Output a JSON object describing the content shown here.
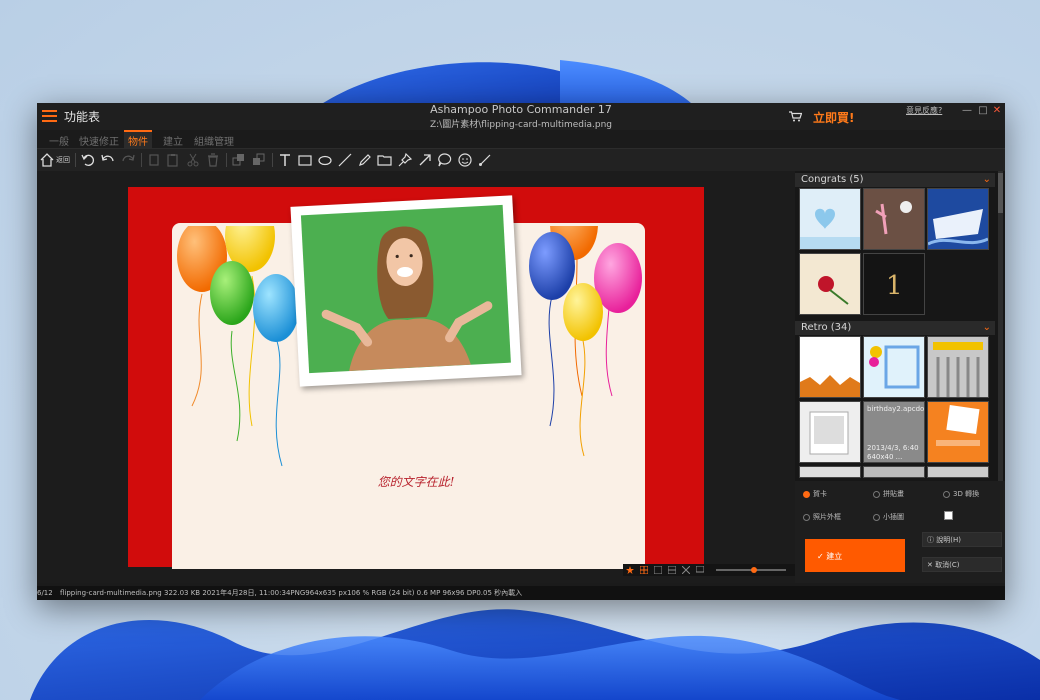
{
  "colors": {
    "accent": "#ff6a13",
    "card_red": "#d10c0c",
    "photo_green": "#4caf50",
    "card_text": "#b8232e"
  },
  "titlebar": {
    "menu_label": "功能表",
    "app_title": "Ashampoo Photo Commander 17",
    "file_path": "Z:\\圖片素材\\flipping-card-multimedia.png",
    "buy_now": "立即買!",
    "feedback": "意見反應?",
    "min_glyph": "—",
    "max_glyph": "□",
    "close_glyph": "✕"
  },
  "tabs": [
    {
      "label": "一般"
    },
    {
      "label": "快速修正"
    },
    {
      "label": "物件"
    },
    {
      "label": "建立"
    },
    {
      "label": "組織管理"
    }
  ],
  "toolbar": {
    "home_label": "返回"
  },
  "card": {
    "text": "您的文字在此!"
  },
  "panel": {
    "section1": "Congrats (5)",
    "section2": "Retro (34)",
    "thumb_caption": "birthday2.apcdo",
    "thumb_meta": "2013/4/3, 6:40",
    "thumb_size": "640x40 ..."
  },
  "options": {
    "radio1": "賀卡",
    "radio2": "拼貼畫",
    "radio3": "3D 轉換",
    "radio4": "照片外框",
    "radio5": "小插圖",
    "build": "建立",
    "help": "說明(H)",
    "cancel": "取消(C)"
  },
  "status": {
    "index": "6/12",
    "filename": "flipping-card-multimedia.png",
    "info": "322.03 KB 2021年4月28日, 11:00:34PNG964x635 px106 %  RGB (24 bit)  0.6 MP 96x96 DP0.05 秒內載入"
  }
}
